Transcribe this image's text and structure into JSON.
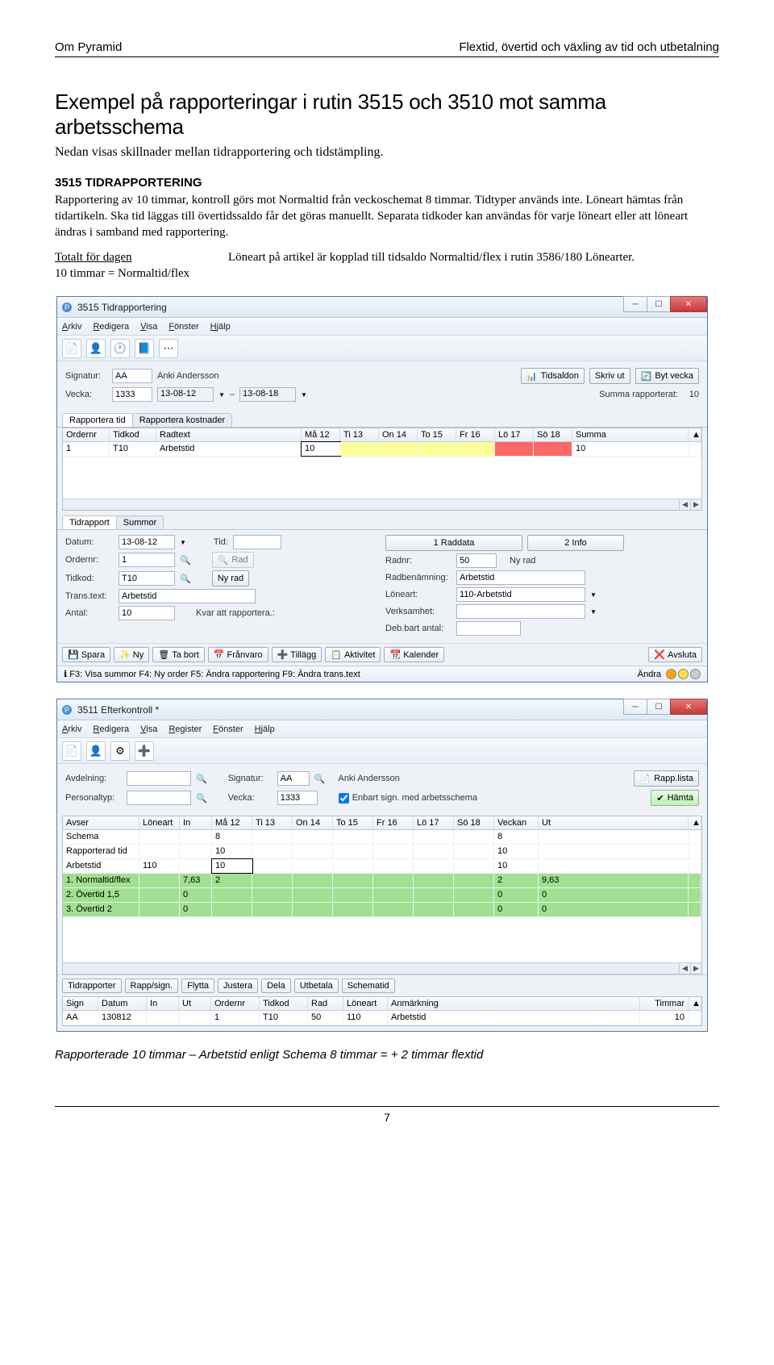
{
  "header": {
    "left": "Om Pyramid",
    "right": "Flextid, övertid och växling av tid och utbetalning"
  },
  "h1": "Exempel på rapporteringar i rutin 3515 och 3510 mot samma arbetsschema",
  "intro": "Nedan visas skillnader mellan tidrapportering och tidstämpling.",
  "sec1_h": "3515 TIDRAPPORTERING",
  "sec1_p": "Rapportering av 10 timmar, kontroll görs mot Normaltid från veckoschemat 8 timmar. Tidtyper används inte. Löneart hämtas från tidartikeln. Ska tid läggas till övertidssaldo får det göras manuellt. Separata tidkoder kan användas för varje löneart eller att löneart ändras i samband med rapportering.",
  "total": {
    "u": "Totalt för dagen",
    "l2": "10 timmar = Normaltid/flex",
    "r": "Löneart på artikel är kopplad till tidsaldo Normaltid/flex i rutin 3586/180 Lönearter."
  },
  "win1": {
    "title": "3515 Tidrapportering",
    "menu": [
      "Arkiv",
      "Redigera",
      "Visa",
      "Fönster",
      "Hjälp"
    ],
    "sign_lbl": "Signatur:",
    "sign_v": "AA",
    "sign_name": "Anki Andersson",
    "vecka_lbl": "Vecka:",
    "vecka_v": "1333",
    "date_from": "13-08-12",
    "date_to": "13-08-18",
    "tidsaldon": "Tidsaldon",
    "skrivut": "Skriv ut",
    "bytvecka": "Byt vecka",
    "summa_lbl": "Summa rapporterat:",
    "summa_v": "10",
    "tabs": [
      "Rapportera tid",
      "Rapportera kostnader"
    ],
    "ghead": [
      "Ordernr",
      "Tidkod",
      "Radtext",
      "Må 12",
      "Ti 13",
      "On 14",
      "To 15",
      "Fr 16",
      "Lö 17",
      "Sö 18",
      "Summa"
    ],
    "row1": {
      "order": "1",
      "tidkod": "T10",
      "radtext": "Arbetstid",
      "ma": "10",
      "summa": "10"
    },
    "sub_tabs": [
      "Tidrapport",
      "Summor"
    ],
    "raddata": "1 Raddata",
    "info": "2 Info",
    "left": {
      "datum_l": "Datum:",
      "datum_v": "13-08-12",
      "tid_l": "Tid:",
      "order_l": "Ordernr:",
      "order_v": "1",
      "rad_b": "Rad",
      "tidkod_l": "Tidkod:",
      "tidkod_v": "T10",
      "nyrad_b": "Ny rad",
      "trans_l": "Trans.text:",
      "trans_v": "Arbetstid",
      "antal_l": "Antal:",
      "antal_v": "10",
      "kvar_l": "Kvar att rapportera.:"
    },
    "right": {
      "radnr_l": "Radnr:",
      "radnr_v": "50",
      "nyrad": "Ny rad",
      "radben_l": "Radbenämning:",
      "radben_v": "Arbetstid",
      "loneart_l": "Löneart:",
      "loneart_v": "110-Arbetstid",
      "verk_l": "Verksamhet:",
      "deb_l": "Deb.bart antal:"
    },
    "actions": [
      "Spara",
      "Ny",
      "Ta bort",
      "Frånvaro",
      "Tillägg",
      "Aktivitet",
      "Kalender",
      "Avsluta"
    ],
    "status": "F3: Visa summor  F4: Ny order  F5: Ändra rapportering  F9: Ändra trans.text",
    "andra": "Ändra"
  },
  "win2": {
    "title": "3511 Efterkontroll *",
    "menu": [
      "Arkiv",
      "Redigera",
      "Visa",
      "Register",
      "Fönster",
      "Hjälp"
    ],
    "avd_l": "Avdelning:",
    "sign_l": "Signatur:",
    "sign_v": "AA",
    "sign_name": "Anki Andersson",
    "pers_l": "Personaltyp:",
    "vecka_l": "Vecka:",
    "vecka_v": "1333",
    "enb": "Enbart sign. med arbetsschema",
    "rapplista": "Rapp.lista",
    "hamta": "Hämta",
    "ghead": [
      "Avser",
      "Löneart",
      "In",
      "Må 12",
      "Ti 13",
      "On 14",
      "To 15",
      "Fr 16",
      "Lö 17",
      "Sö 18",
      "Veckan",
      "Ut"
    ],
    "rows": [
      {
        "avser": "Schema",
        "lon": "",
        "in": "",
        "ma": "8",
        "ti": "",
        "on": "",
        "to": "",
        "fr": "",
        "lo": "",
        "so": "",
        "v": "8",
        "ut": ""
      },
      {
        "avser": "Rapporterad tid",
        "lon": "",
        "in": "",
        "ma": "10",
        "ti": "",
        "on": "",
        "to": "",
        "fr": "",
        "lo": "",
        "so": "",
        "v": "10",
        "ut": ""
      },
      {
        "avser": "Arbetstid",
        "lon": "110",
        "in": "",
        "ma": "10",
        "ti": "",
        "on": "",
        "to": "",
        "fr": "",
        "lo": "",
        "so": "",
        "v": "10",
        "ut": ""
      },
      {
        "avser": "1. Normaltid/flex",
        "lon": "",
        "in": "7,63",
        "ma": "2",
        "ti": "",
        "on": "",
        "to": "",
        "fr": "",
        "lo": "",
        "so": "",
        "v": "2",
        "ut": "9,63",
        "green": true
      },
      {
        "avser": "2. Övertid 1,5",
        "lon": "",
        "in": "0",
        "ma": "",
        "ti": "",
        "on": "",
        "to": "",
        "fr": "",
        "lo": "",
        "so": "",
        "v": "0",
        "ut": "0",
        "green": true
      },
      {
        "avser": "3. Övertid 2",
        "lon": "",
        "in": "0",
        "ma": "",
        "ti": "",
        "on": "",
        "to": "",
        "fr": "",
        "lo": "",
        "so": "",
        "v": "0",
        "ut": "0",
        "green": true
      }
    ],
    "bbtns": [
      "Tidrapporter",
      "Rapp/sign.",
      "Flytta",
      "Justera",
      "Dela",
      "Utbetala",
      "Schematid"
    ],
    "ghead2": [
      "Sign",
      "Datum",
      "In",
      "Ut",
      "Ordernr",
      "Tidkod",
      "Rad",
      "Löneart",
      "Anmärkning",
      "Timmar"
    ],
    "row2": {
      "sign": "AA",
      "datum": "130812",
      "in": "",
      "ut": "",
      "order": "1",
      "tidkod": "T10",
      "rad": "50",
      "lon": "110",
      "anm": "Arbetstid",
      "tim": "10"
    }
  },
  "caption": "Rapporterade 10 timmar – Arbetstid enligt Schema 8 timmar = + 2 timmar flextid",
  "page_num": "7"
}
